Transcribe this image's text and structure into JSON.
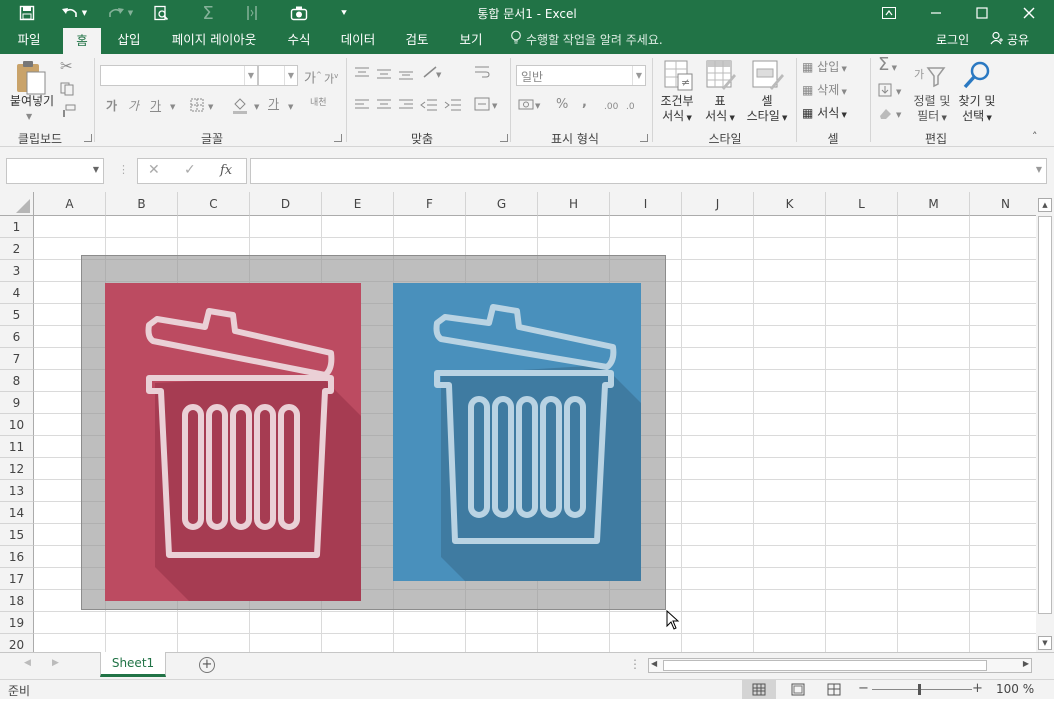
{
  "window": {
    "title": "통합 문서1 - Excel"
  },
  "tabs": [
    {
      "label": "파일"
    },
    {
      "label": "홈"
    },
    {
      "label": "삽입"
    },
    {
      "label": "페이지 레이아웃"
    },
    {
      "label": "수식"
    },
    {
      "label": "데이터"
    },
    {
      "label": "검토"
    },
    {
      "label": "보기"
    }
  ],
  "tell_me": "수행할 작업을 알려 주세요.",
  "login": "로그인",
  "share": "공유",
  "ribbon": {
    "clipboard": {
      "label": "클립보드",
      "paste": "붙여넣기"
    },
    "font": {
      "label": "글꼴",
      "bold": "가",
      "italic": "가",
      "underline": "가",
      "grow": "가",
      "shrink": "가",
      "font_color": "가",
      "phonetic": "내천"
    },
    "align": {
      "label": "맞춤"
    },
    "number": {
      "label": "표시 형식",
      "format": "일반",
      "percent": "%",
      "comma": ",",
      "inc": ".00",
      "dec": ".0"
    },
    "styles": {
      "label": "스타일",
      "cond": "조건부 서식",
      "cond_l1": "조건부",
      "cond_l2": "서식",
      "table_l1": "표",
      "table_l2": "서식",
      "cell_l1": "셀",
      "cell_l2": "스타일"
    },
    "cells": {
      "label": "셀",
      "insert": "삽입",
      "delete": "삭제",
      "format": "서식"
    },
    "editing": {
      "label": "편집",
      "sort_l1": "정렬 및",
      "sort_l2": "필터",
      "find_l1": "찾기 및",
      "find_l2": "선택"
    }
  },
  "formula_bar": {
    "name_box": "",
    "formula": "",
    "fx": "fx"
  },
  "columns": [
    "A",
    "B",
    "C",
    "D",
    "E",
    "F",
    "G",
    "H",
    "I",
    "J",
    "K",
    "L",
    "M",
    "N"
  ],
  "rows": [
    "1",
    "2",
    "3",
    "4",
    "5",
    "6",
    "7",
    "8",
    "9",
    "10",
    "11",
    "12",
    "13",
    "14",
    "15",
    "16",
    "17",
    "18",
    "19",
    "20"
  ],
  "images": [
    {
      "name": "trash-red",
      "bg": "#bc4b61",
      "shadow": "#a63c52"
    },
    {
      "name": "trash-blue",
      "bg": "#4990bc",
      "shadow": "#3f7ba1"
    }
  ],
  "sheet_tabs": [
    {
      "label": "Sheet1"
    }
  ],
  "status": {
    "mode": "준비",
    "zoom": "100 %"
  },
  "colors": {
    "brand": "#217346",
    "ribbon_bg": "#f3f3f3"
  }
}
